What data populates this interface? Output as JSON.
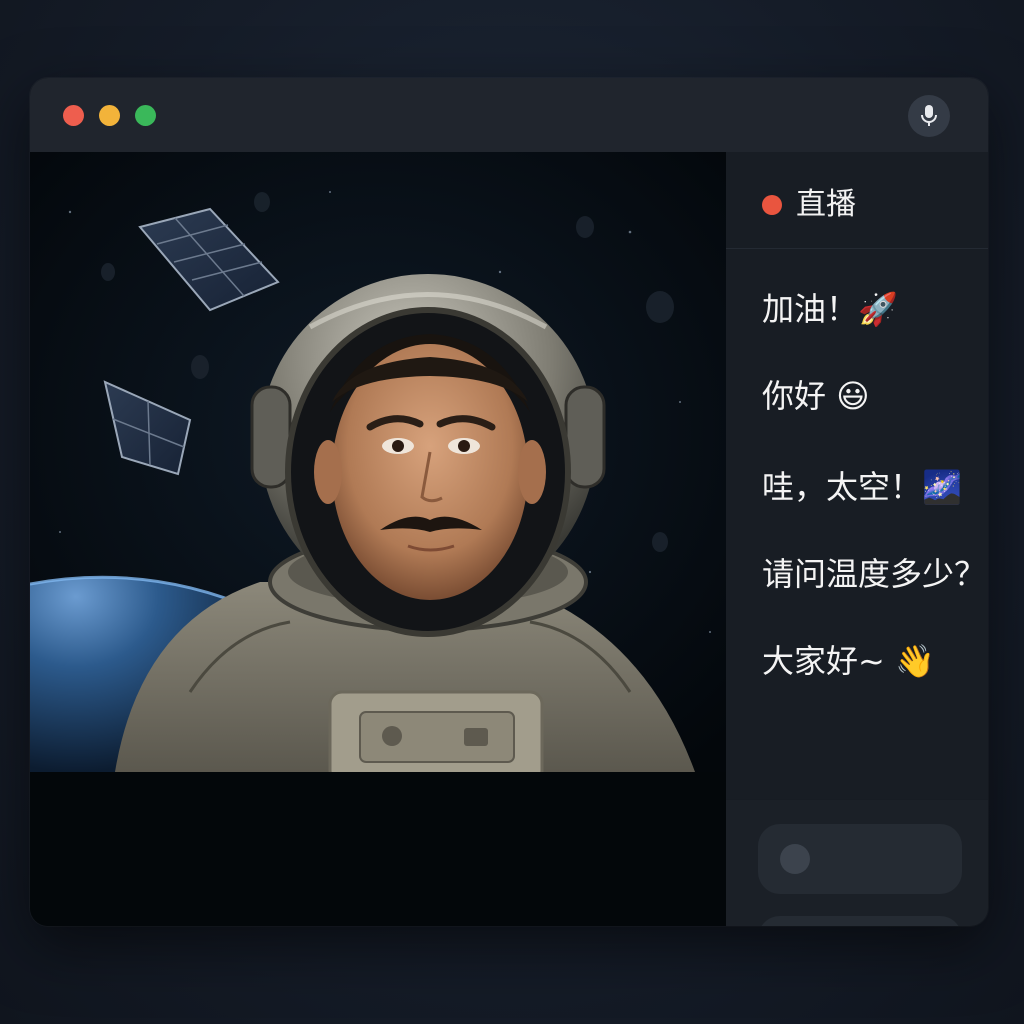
{
  "window": {
    "controls": [
      "close",
      "minimize",
      "maximize"
    ],
    "mic_icon": "microphone-icon"
  },
  "stream": {
    "live_label": "直播",
    "live_color": "#e9553f"
  },
  "chat": {
    "messages": [
      {
        "text": "加油！",
        "emoji": "🚀"
      },
      {
        "text": "你好",
        "emoji": "😃"
      },
      {
        "text": "哇，太空！",
        "emoji": "🌌"
      },
      {
        "text": "请问温度多少？",
        "emoji": ""
      },
      {
        "text": "大家好~",
        "emoji": "👋"
      }
    ]
  },
  "input": {
    "fields": [
      "comment-input",
      "send-area"
    ]
  },
  "colors": {
    "close": "#ee5e4e",
    "minimize": "#f2b33a",
    "maximize": "#3ab85a",
    "accent": "#e9553f"
  }
}
